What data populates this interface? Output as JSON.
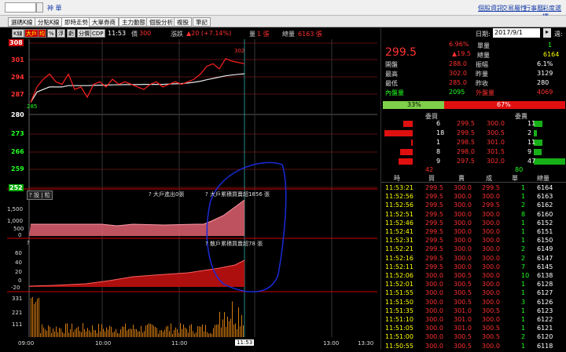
{
  "topbar": {
    "stock_label": "神 華",
    "links": [
      "個股資訊",
      "交易屬性",
      "行事曆",
      "彩度選擇"
    ]
  },
  "tabs": [
    "選碼K線",
    "分點K線",
    "即時走勢",
    "大單券商",
    "主力動態",
    "個股分析",
    "複股",
    "筆記"
  ],
  "toolbar": {
    "buttons": [
      "K線",
      "大戶",
      "均",
      "%",
      "浮",
      "虧",
      "分價",
      "CDP"
    ],
    "time": "11:53",
    "price_label": "價",
    "price": "300",
    "change_label": "漲跌",
    "change": "▲20 (+7.14%)",
    "vol_label": "量",
    "vol": "1 張",
    "total_label": "總量",
    "total": "6163 張"
  },
  "price_axis": [
    "308",
    "301",
    "294",
    "287",
    "280",
    "273",
    "266",
    "259",
    "252"
  ],
  "price_hi_mark": "302",
  "price_lo_mark": "285",
  "panel2": {
    "tag1": "大戶進出0張",
    "tag2": "大戶累積買賣超1856 張",
    "axis": [
      "1,500",
      "1,000",
      "500",
      "0"
    ]
  },
  "panel3": {
    "tag": "散戶累積買賣超78 張",
    "axis": [
      "60",
      "40",
      "20",
      "0",
      "-20"
    ]
  },
  "panel4": {
    "axis": [
      "331",
      "221",
      "111"
    ]
  },
  "time_axis": [
    "09:00",
    "10:00",
    "11:00",
    "11:53",
    "13:00",
    "13:30"
  ],
  "right": {
    "date_label": "日期:",
    "date": "2017/9/1",
    "week_label": "週:",
    "price": "299.5",
    "pct": "6.96%",
    "chg": "▲19.5",
    "q": [
      [
        "單量",
        "1"
      ],
      [
        "總量",
        "6164"
      ]
    ],
    "stats": [
      [
        "開盤",
        "288.0",
        "振幅",
        "6.1%"
      ],
      [
        "最高",
        "302.0",
        "昨量",
        "3129"
      ],
      [
        "最低",
        "285.0",
        "昨收",
        "280"
      ],
      [
        "內盤量",
        "2095",
        "外盤量",
        "4069"
      ]
    ],
    "bar_left": "33%",
    "bar_right": "67%",
    "book_head": [
      "委買",
      "委賣"
    ],
    "book": [
      [
        "6",
        "299.5",
        "300.0",
        "11"
      ],
      [
        "18",
        "299.5",
        "300.5",
        "2"
      ],
      [
        "1",
        "298.5",
        "301.0",
        "11"
      ],
      [
        "8",
        "298.0",
        "301.5",
        "9"
      ],
      [
        "9",
        "297.5",
        "302.0",
        "47"
      ]
    ],
    "book_tot": [
      "42",
      "80"
    ],
    "tick_head": [
      "時",
      "買",
      "賣",
      "成",
      "單",
      "總量"
    ],
    "ticks": [
      [
        "11:53:21",
        "299.5",
        "300.0",
        "299.5",
        "1",
        "6164"
      ],
      [
        "11:52:56",
        "299.5",
        "300.0",
        "300.0",
        "1",
        "6163"
      ],
      [
        "11:52:56",
        "299.5",
        "300.0",
        "299.5",
        "2",
        "6162"
      ],
      [
        "11:52:51",
        "299.5",
        "300.0",
        "300.0",
        "8",
        "6160"
      ],
      [
        "11:52:46",
        "299.5",
        "300.0",
        "300.0",
        "1",
        "6152"
      ],
      [
        "11:52:41",
        "299.5",
        "300.0",
        "300.0",
        "1",
        "6151"
      ],
      [
        "11:52:31",
        "299.5",
        "300.0",
        "300.0",
        "1",
        "6150"
      ],
      [
        "11:52:21",
        "299.5",
        "300.0",
        "300.0",
        "2",
        "6149"
      ],
      [
        "11:52:16",
        "299.5",
        "300.0",
        "300.0",
        "2",
        "6147"
      ],
      [
        "11:52:11",
        "299.5",
        "300.0",
        "300.0",
        "7",
        "6145"
      ],
      [
        "11:52:06",
        "300.0",
        "300.5",
        "300.0",
        "10",
        "6138"
      ],
      [
        "11:52:01",
        "300.0",
        "300.5",
        "300.0",
        "1",
        "6128"
      ],
      [
        "11:51:55",
        "300.0",
        "300.5",
        "300.0",
        "1",
        "6127"
      ],
      [
        "11:51:50",
        "300.0",
        "300.5",
        "300.0",
        "3",
        "6126"
      ],
      [
        "11:51:35",
        "300.0",
        "301.0",
        "300.5",
        "1",
        "6123"
      ],
      [
        "11:51:10",
        "300.0",
        "301.0",
        "300.0",
        "1",
        "6122"
      ],
      [
        "11:51:05",
        "300.0",
        "301.0",
        "300.5",
        "1",
        "6121"
      ],
      [
        "11:51:00",
        "300.0",
        "300.5",
        "300.5",
        "2",
        "6120"
      ],
      [
        "11:50:55",
        "300.0",
        "300.5",
        "300.0",
        "1",
        "6118"
      ]
    ]
  },
  "chart_data": {
    "type": "line",
    "price_range": [
      252,
      308
    ],
    "price_points": [
      285,
      291,
      294,
      296,
      293,
      292,
      296,
      290,
      291,
      287,
      292,
      293,
      291,
      294,
      292,
      293,
      292,
      291,
      290,
      292,
      293,
      291,
      292,
      293,
      292,
      293,
      294,
      296,
      299,
      300,
      298,
      302,
      301,
      300.5,
      300
    ],
    "avg_points": [
      285,
      289,
      290,
      291,
      291,
      291,
      291.5,
      291.5,
      291.5,
      291.5,
      291.6,
      291.7,
      291.7,
      291.8,
      291.8,
      291.9,
      291.9,
      291.9,
      292,
      292,
      292,
      292,
      292.1,
      292.2,
      292.3,
      292.5,
      292.8,
      293.2,
      293.8,
      294.3,
      294.8,
      295.3,
      295.6,
      295.9,
      296.1
    ]
  }
}
